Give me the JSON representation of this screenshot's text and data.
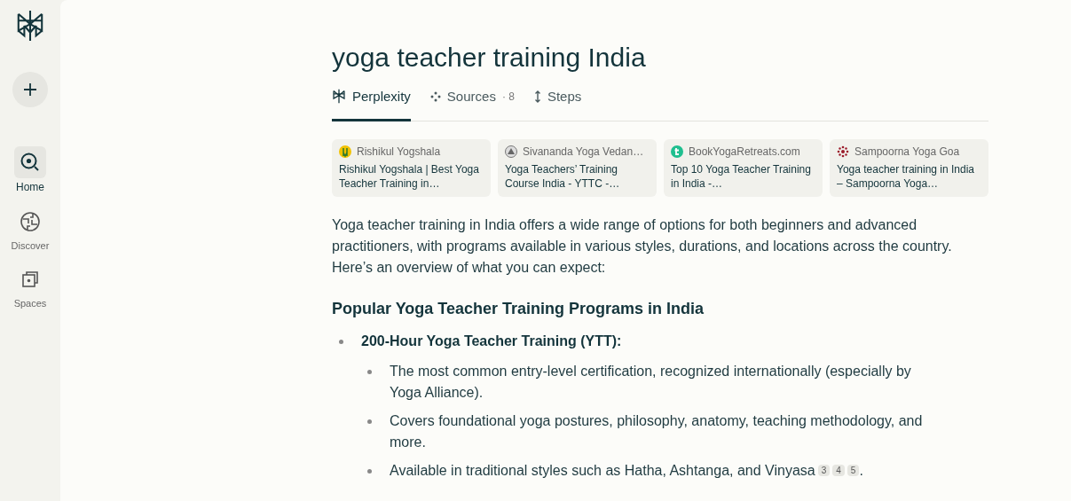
{
  "sidebar": {
    "items": [
      {
        "label": "Home",
        "selected": true
      },
      {
        "label": "Discover",
        "selected": false
      },
      {
        "label": "Spaces",
        "selected": false
      }
    ]
  },
  "title": "yoga teacher training India",
  "tabs": [
    {
      "label": "Perplexity",
      "selected": true
    },
    {
      "label": "Sources",
      "count": "· 8",
      "selected": false
    },
    {
      "label": "Steps",
      "selected": false
    }
  ],
  "sources": [
    {
      "site": "Rishikul Yogshala",
      "title": "Rishikul Yogshala | Best Yoga Teacher Training in…"
    },
    {
      "site": "Sivananda Yoga Vedan…",
      "title": "Yoga Teachers’ Training Course India - YTTC -…"
    },
    {
      "site": "BookYogaRetreats.com",
      "title": "Top 10 Yoga Teacher Training in India -…"
    },
    {
      "site": "Sampoorna Yoga Goa",
      "title": "Yoga teacher training in India – Sampoorna Yoga…"
    }
  ],
  "intro": "Yoga teacher training in India offers a wide range of options for both beginners and advanced practitioners, with programs available in various styles, durations, and locations across the country. Here’s an overview of what you can expect:",
  "heading": "Popular Yoga Teacher Training Programs in India",
  "list": [
    {
      "text": "200-Hour Yoga Teacher Training (YTT):",
      "children": [
        {
          "text": "The most common entry-level certification, recognized internationally (especially by Yoga Alliance)."
        },
        {
          "text": "Covers foundational yoga postures, philosophy, anatomy, teaching methodology, and more."
        },
        {
          "text": "Available in traditional styles such as Hatha, Ashtanga, and Vinyasa",
          "citations": [
            "3",
            "4",
            "5"
          ],
          "end": "."
        }
      ]
    }
  ]
}
